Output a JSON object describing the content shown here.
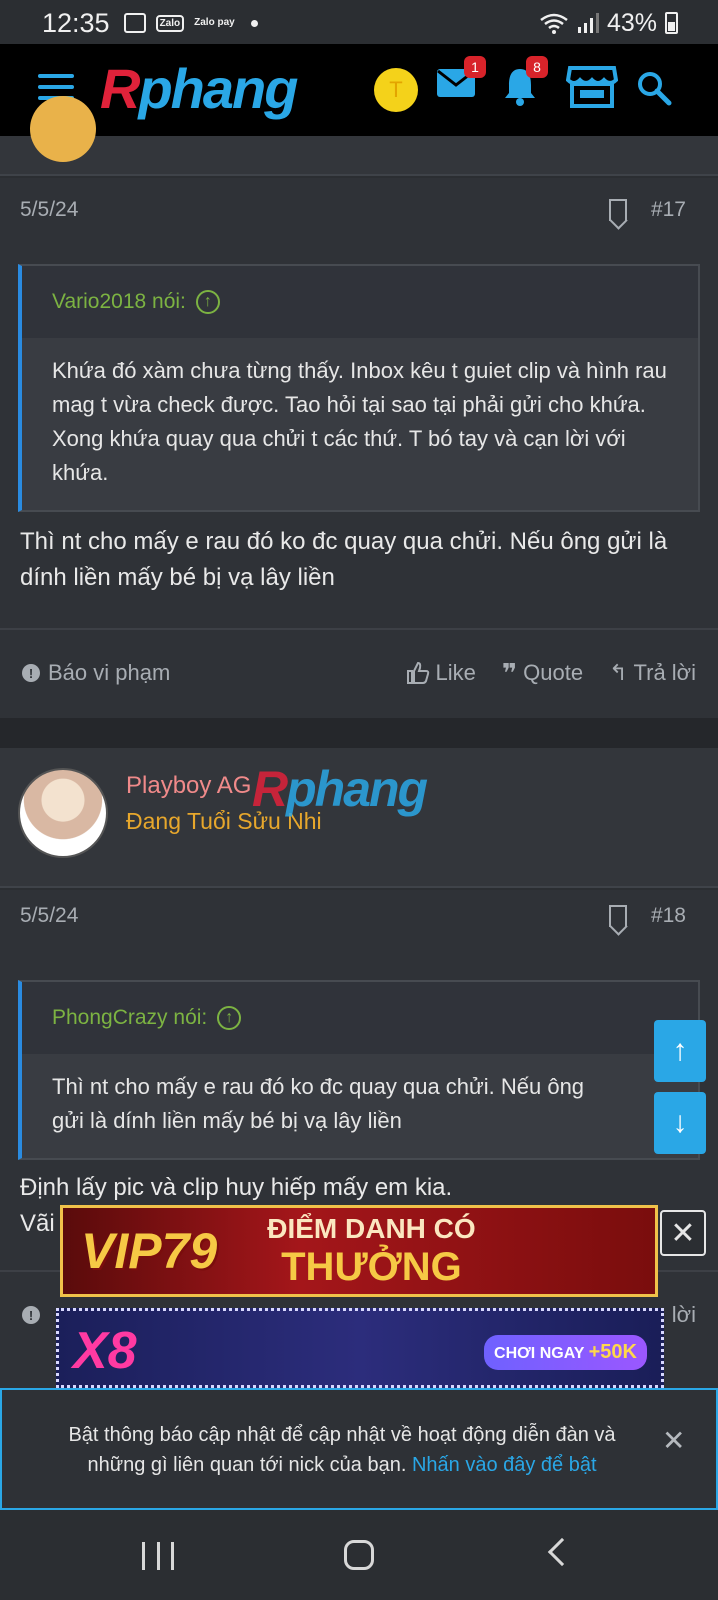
{
  "status_bar": {
    "time": "12:35",
    "zalo": "Zalo",
    "zalopay": "Zalo pay",
    "battery": "43%"
  },
  "header": {
    "logo_r": "R",
    "logo_rest": "phang",
    "avatar_letter": "T",
    "messages_badge": "1",
    "alerts_badge": "8"
  },
  "posts": [
    {
      "date": "5/5/24",
      "number": "#17",
      "quote_author": "Vario2018 nói:",
      "quote_text": "Khứa đó xàm chưa từng thấy. Inbox kêu t guiet clip và hình rau mag t vừa check được. Tao hỏi tại sao tại phải gửi cho khứa. Xong khứa quay qua chửi t các thứ. T bó tay và cạn lời với khứa.",
      "message": "Thì nt cho mấy e rau đó ko đc quay qua chửi. Nếu ông gửi là dính liền mấy bé bị vạ lây liền",
      "report": "Báo vi phạm",
      "like": "Like",
      "quote": "Quote",
      "reply": "Trả lời"
    },
    {
      "user_name": "Playboy AG",
      "user_title": "Đang Tuổi Sửu Nhi",
      "date": "5/5/24",
      "number": "#18",
      "quote_author": "PhongCrazy nói:",
      "quote_text": "Thì nt cho mấy e rau đó ko đc quay qua chửi. Nếu ông gửi là dính liền mấy bé bị vạ lây liền",
      "message_line1": "Định lấy pic và clip huy hiếp mấy em kia.",
      "message_line2": "Vãi",
      "reply_tail": "lời"
    }
  ],
  "ads": {
    "vip": "VIP79",
    "ad1_line1": "ĐIỂM DANH CÓ",
    "ad1_line2": "THƯỞNG",
    "x8": "X8",
    "play_now": "CHƠI NGAY",
    "bonus": "+50K"
  },
  "notification": {
    "text": "Bật thông báo cập nhật để cập nhật về hoạt động diễn đàn và những gì liên quan tới nick của bạn.",
    "link": "Nhấn vào đây để bật"
  }
}
